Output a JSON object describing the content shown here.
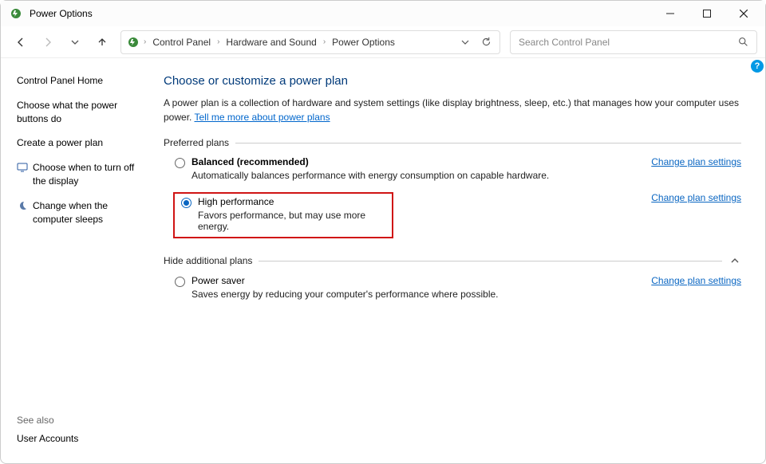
{
  "window": {
    "title": "Power Options"
  },
  "breadcrumb": {
    "items": [
      "Control Panel",
      "Hardware and Sound",
      "Power Options"
    ]
  },
  "search": {
    "placeholder": "Search Control Panel"
  },
  "sidebar": {
    "home": "Control Panel Home",
    "links": {
      "choose_buttons": "Choose what the power buttons do",
      "create_plan": "Create a power plan",
      "turn_off_display": "Choose when to turn off the display",
      "change_sleep": "Change when the computer sleeps"
    },
    "see_also_label": "See also",
    "see_also_link": "User Accounts"
  },
  "main": {
    "heading": "Choose or customize a power plan",
    "description_pre": "A power plan is a collection of hardware and system settings (like display brightness, sleep, etc.) that manages how your computer uses power. ",
    "description_link": "Tell me more about power plans",
    "preferred_label": "Preferred plans",
    "hide_label": "Hide additional plans",
    "change_settings": "Change plan settings",
    "plans": {
      "balanced": {
        "name": "Balanced (recommended)",
        "desc": "Automatically balances performance with energy consumption on capable hardware."
      },
      "high_perf": {
        "name": "High performance",
        "desc": "Favors performance, but may use more energy."
      },
      "power_saver": {
        "name": "Power saver",
        "desc": "Saves energy by reducing your computer's performance where possible."
      }
    }
  }
}
